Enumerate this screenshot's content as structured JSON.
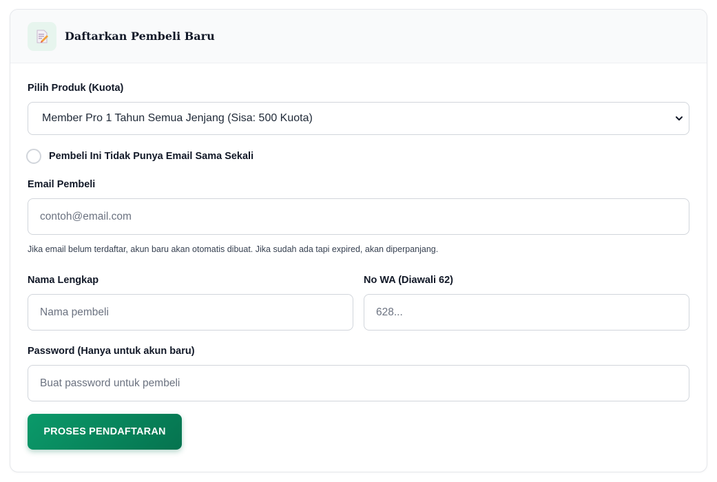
{
  "header": {
    "title": "Daftarkan Pembeli Baru",
    "icon": "memo-icon"
  },
  "form": {
    "product_label": "Pilih Produk (Kuota)",
    "product_selected": "Member Pro 1 Tahun Semua Jenjang (Sisa: 500 Kuota)",
    "no_email_checkbox": {
      "label": "Pembeli Ini Tidak Punya Email Sama Sekali",
      "checked": false
    },
    "email_label": "Email Pembeli",
    "email_placeholder": "contoh@email.com",
    "email_hint": "Jika email belum terdaftar, akun baru akan otomatis dibuat. Jika sudah ada tapi expired, akan diperpanjang.",
    "name_label": "Nama Lengkap",
    "name_placeholder": "Nama pembeli",
    "wa_label": "No WA (Diawali 62)",
    "wa_placeholder": "628...",
    "password_label": "Password (Hanya untuk akun baru)",
    "password_placeholder": "Buat password untuk pembeli",
    "submit_label": "PROSES PENDAFTARAN"
  },
  "colors": {
    "accent": "#05734f",
    "accent_light": "#0b9a6a",
    "header_bg": "#f9fafb",
    "border": "#d1d5db"
  }
}
